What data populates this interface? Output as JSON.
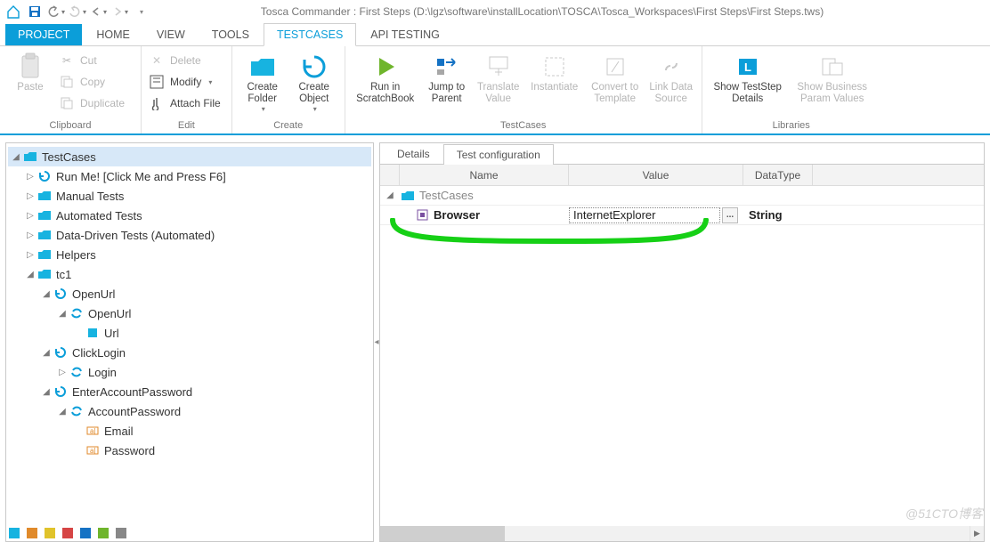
{
  "title": "Tosca Commander : First Steps (D:\\lgz\\software\\installLocation\\TOSCA\\Tosca_Workspaces\\First Steps\\First Steps.tws)",
  "maintabs": {
    "project": "PROJECT",
    "home": "HOME",
    "view": "VIEW",
    "tools": "TOOLS",
    "testcases": "TESTCASES",
    "api": "API TESTING"
  },
  "ribbon": {
    "clipboard": {
      "paste": "Paste",
      "cut": "Cut",
      "copy": "Copy",
      "duplicate": "Duplicate",
      "cap": "Clipboard"
    },
    "edit": {
      "delete": "Delete",
      "modify": "Modify",
      "attach": "Attach File",
      "cap": "Edit"
    },
    "create": {
      "folder": "Create\nFolder",
      "object": "Create\nObject",
      "cap": "Create"
    },
    "testcases": {
      "run": "Run in\nScratchBook",
      "jump": "Jump to\nParent",
      "translate": "Translate\nValue",
      "instantiate": "Instantiate",
      "convert": "Convert to\nTemplate",
      "link": "Link Data\nSource",
      "cap": "TestCases"
    },
    "libraries": {
      "show_ts": "Show TestStep\nDetails",
      "show_bp": "Show Business\nParam Values",
      "cap": "Libraries"
    }
  },
  "tree": {
    "root": "TestCases",
    "n1": "Run Me! [Click Me and Press F6]",
    "n2": "Manual Tests",
    "n3": "Automated Tests",
    "n4": "Data-Driven Tests (Automated)",
    "n5": "Helpers",
    "n6": "tc1",
    "n6a": "OpenUrl",
    "n6a1": "OpenUrl",
    "n6a1a": "Url",
    "n6b": "ClickLogin",
    "n6b1": "Login",
    "n6c": "EnterAccountPassword",
    "n6c1": "AccountPassword",
    "n6c1a": "Email",
    "n6c1b": "Password"
  },
  "detailtabs": {
    "details": "Details",
    "testconfig": "Test configuration"
  },
  "grid": {
    "h_name": "Name",
    "h_value": "Value",
    "h_type": "DataType",
    "r0": "TestCases",
    "r1_name": "Browser",
    "r1_value": "InternetExplorer",
    "r1_type": "String",
    "ell": "..."
  },
  "watermark": "@51CTO博客"
}
